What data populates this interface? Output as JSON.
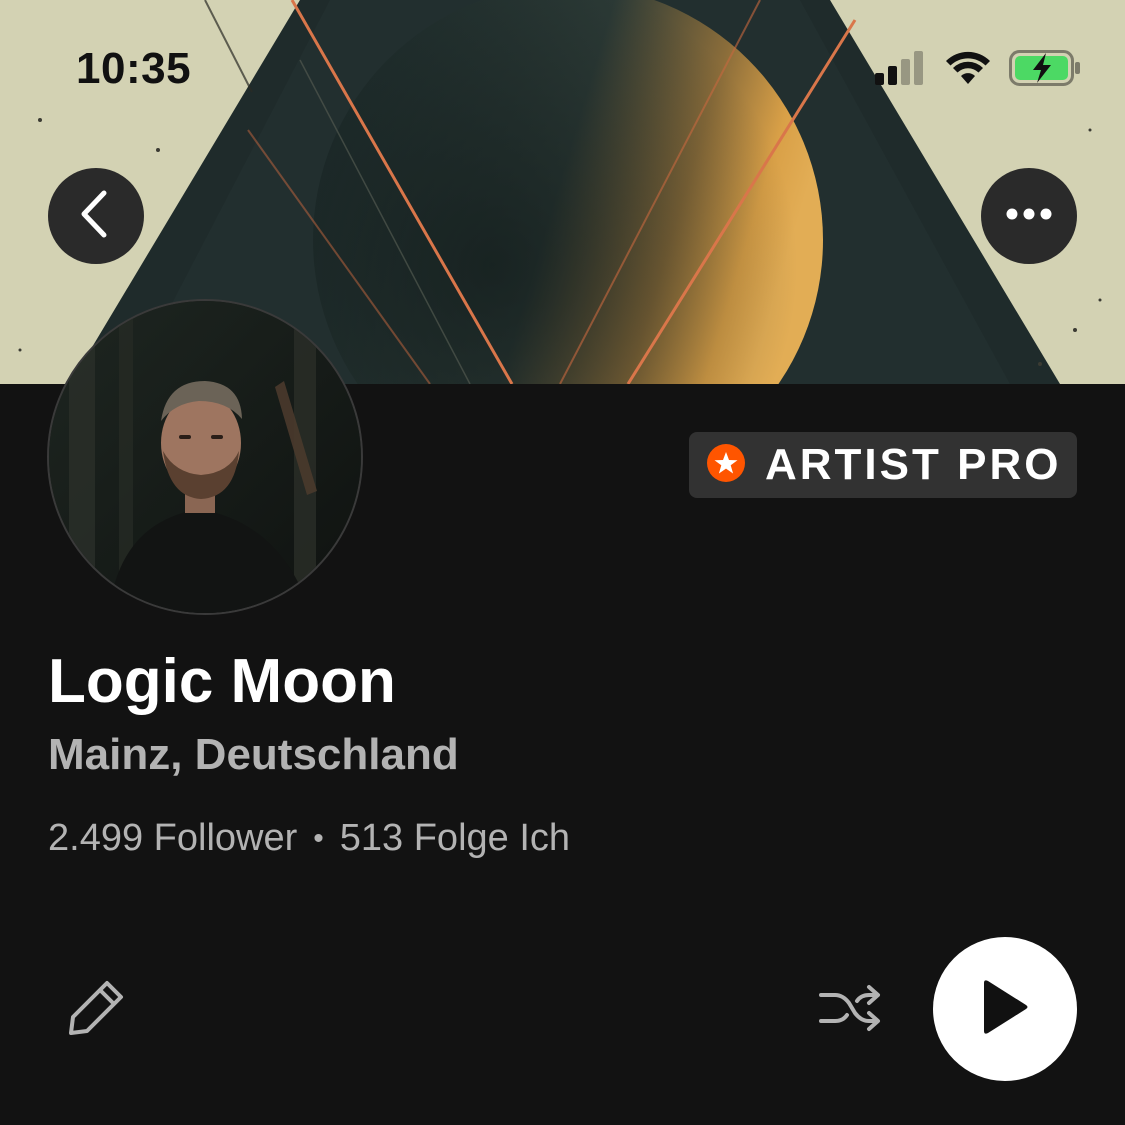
{
  "status_bar": {
    "time": "10:35",
    "icons": [
      "signal-icon",
      "wifi-icon",
      "battery-charging-icon"
    ]
  },
  "header": {
    "back_icon": "chevron-left-icon",
    "more_icon": "more-horizontal-icon"
  },
  "profile": {
    "badge_label": "ARTIST PRO",
    "badge_icon": "star-icon",
    "name": "Logic Moon",
    "location": "Mainz, Deutschland",
    "followers": "2.499 Follower",
    "separator": "•",
    "following": "513 Folge Ich"
  },
  "actions": {
    "edit_icon": "pencil-icon",
    "shuffle_icon": "shuffle-icon",
    "play_icon": "play-icon"
  },
  "colors": {
    "background": "#121212",
    "accent": "#ff5500",
    "badge_bg": "#323232",
    "secondary_text": "#b3b3b3",
    "banner_cream": "#d3d2b3",
    "banner_dark": "#1f2b2b",
    "banner_orange": "#d9a047"
  }
}
